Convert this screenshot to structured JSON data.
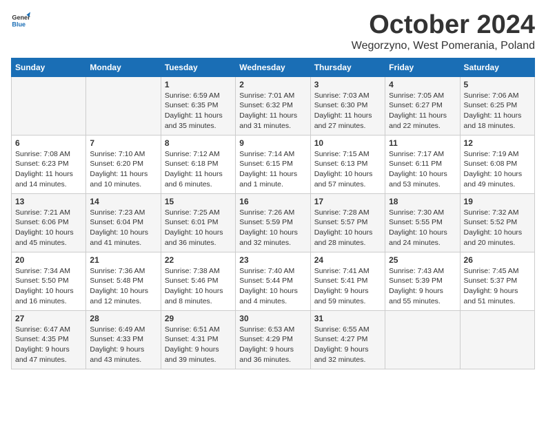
{
  "logo": {
    "general": "General",
    "blue": "Blue"
  },
  "title": {
    "month": "October 2024",
    "location": "Wegorzyno, West Pomerania, Poland"
  },
  "headers": [
    "Sunday",
    "Monday",
    "Tuesday",
    "Wednesday",
    "Thursday",
    "Friday",
    "Saturday"
  ],
  "weeks": [
    [
      {
        "day": "",
        "sunrise": "",
        "sunset": "",
        "daylight": ""
      },
      {
        "day": "",
        "sunrise": "",
        "sunset": "",
        "daylight": ""
      },
      {
        "day": "1",
        "sunrise": "Sunrise: 6:59 AM",
        "sunset": "Sunset: 6:35 PM",
        "daylight": "Daylight: 11 hours and 35 minutes."
      },
      {
        "day": "2",
        "sunrise": "Sunrise: 7:01 AM",
        "sunset": "Sunset: 6:32 PM",
        "daylight": "Daylight: 11 hours and 31 minutes."
      },
      {
        "day": "3",
        "sunrise": "Sunrise: 7:03 AM",
        "sunset": "Sunset: 6:30 PM",
        "daylight": "Daylight: 11 hours and 27 minutes."
      },
      {
        "day": "4",
        "sunrise": "Sunrise: 7:05 AM",
        "sunset": "Sunset: 6:27 PM",
        "daylight": "Daylight: 11 hours and 22 minutes."
      },
      {
        "day": "5",
        "sunrise": "Sunrise: 7:06 AM",
        "sunset": "Sunset: 6:25 PM",
        "daylight": "Daylight: 11 hours and 18 minutes."
      }
    ],
    [
      {
        "day": "6",
        "sunrise": "Sunrise: 7:08 AM",
        "sunset": "Sunset: 6:23 PM",
        "daylight": "Daylight: 11 hours and 14 minutes."
      },
      {
        "day": "7",
        "sunrise": "Sunrise: 7:10 AM",
        "sunset": "Sunset: 6:20 PM",
        "daylight": "Daylight: 11 hours and 10 minutes."
      },
      {
        "day": "8",
        "sunrise": "Sunrise: 7:12 AM",
        "sunset": "Sunset: 6:18 PM",
        "daylight": "Daylight: 11 hours and 6 minutes."
      },
      {
        "day": "9",
        "sunrise": "Sunrise: 7:14 AM",
        "sunset": "Sunset: 6:15 PM",
        "daylight": "Daylight: 11 hours and 1 minute."
      },
      {
        "day": "10",
        "sunrise": "Sunrise: 7:15 AM",
        "sunset": "Sunset: 6:13 PM",
        "daylight": "Daylight: 10 hours and 57 minutes."
      },
      {
        "day": "11",
        "sunrise": "Sunrise: 7:17 AM",
        "sunset": "Sunset: 6:11 PM",
        "daylight": "Daylight: 10 hours and 53 minutes."
      },
      {
        "day": "12",
        "sunrise": "Sunrise: 7:19 AM",
        "sunset": "Sunset: 6:08 PM",
        "daylight": "Daylight: 10 hours and 49 minutes."
      }
    ],
    [
      {
        "day": "13",
        "sunrise": "Sunrise: 7:21 AM",
        "sunset": "Sunset: 6:06 PM",
        "daylight": "Daylight: 10 hours and 45 minutes."
      },
      {
        "day": "14",
        "sunrise": "Sunrise: 7:23 AM",
        "sunset": "Sunset: 6:04 PM",
        "daylight": "Daylight: 10 hours and 41 minutes."
      },
      {
        "day": "15",
        "sunrise": "Sunrise: 7:25 AM",
        "sunset": "Sunset: 6:01 PM",
        "daylight": "Daylight: 10 hours and 36 minutes."
      },
      {
        "day": "16",
        "sunrise": "Sunrise: 7:26 AM",
        "sunset": "Sunset: 5:59 PM",
        "daylight": "Daylight: 10 hours and 32 minutes."
      },
      {
        "day": "17",
        "sunrise": "Sunrise: 7:28 AM",
        "sunset": "Sunset: 5:57 PM",
        "daylight": "Daylight: 10 hours and 28 minutes."
      },
      {
        "day": "18",
        "sunrise": "Sunrise: 7:30 AM",
        "sunset": "Sunset: 5:55 PM",
        "daylight": "Daylight: 10 hours and 24 minutes."
      },
      {
        "day": "19",
        "sunrise": "Sunrise: 7:32 AM",
        "sunset": "Sunset: 5:52 PM",
        "daylight": "Daylight: 10 hours and 20 minutes."
      }
    ],
    [
      {
        "day": "20",
        "sunrise": "Sunrise: 7:34 AM",
        "sunset": "Sunset: 5:50 PM",
        "daylight": "Daylight: 10 hours and 16 minutes."
      },
      {
        "day": "21",
        "sunrise": "Sunrise: 7:36 AM",
        "sunset": "Sunset: 5:48 PM",
        "daylight": "Daylight: 10 hours and 12 minutes."
      },
      {
        "day": "22",
        "sunrise": "Sunrise: 7:38 AM",
        "sunset": "Sunset: 5:46 PM",
        "daylight": "Daylight: 10 hours and 8 minutes."
      },
      {
        "day": "23",
        "sunrise": "Sunrise: 7:40 AM",
        "sunset": "Sunset: 5:44 PM",
        "daylight": "Daylight: 10 hours and 4 minutes."
      },
      {
        "day": "24",
        "sunrise": "Sunrise: 7:41 AM",
        "sunset": "Sunset: 5:41 PM",
        "daylight": "Daylight: 9 hours and 59 minutes."
      },
      {
        "day": "25",
        "sunrise": "Sunrise: 7:43 AM",
        "sunset": "Sunset: 5:39 PM",
        "daylight": "Daylight: 9 hours and 55 minutes."
      },
      {
        "day": "26",
        "sunrise": "Sunrise: 7:45 AM",
        "sunset": "Sunset: 5:37 PM",
        "daylight": "Daylight: 9 hours and 51 minutes."
      }
    ],
    [
      {
        "day": "27",
        "sunrise": "Sunrise: 6:47 AM",
        "sunset": "Sunset: 4:35 PM",
        "daylight": "Daylight: 9 hours and 47 minutes."
      },
      {
        "day": "28",
        "sunrise": "Sunrise: 6:49 AM",
        "sunset": "Sunset: 4:33 PM",
        "daylight": "Daylight: 9 hours and 43 minutes."
      },
      {
        "day": "29",
        "sunrise": "Sunrise: 6:51 AM",
        "sunset": "Sunset: 4:31 PM",
        "daylight": "Daylight: 9 hours and 39 minutes."
      },
      {
        "day": "30",
        "sunrise": "Sunrise: 6:53 AM",
        "sunset": "Sunset: 4:29 PM",
        "daylight": "Daylight: 9 hours and 36 minutes."
      },
      {
        "day": "31",
        "sunrise": "Sunrise: 6:55 AM",
        "sunset": "Sunset: 4:27 PM",
        "daylight": "Daylight: 9 hours and 32 minutes."
      },
      {
        "day": "",
        "sunrise": "",
        "sunset": "",
        "daylight": ""
      },
      {
        "day": "",
        "sunrise": "",
        "sunset": "",
        "daylight": ""
      }
    ]
  ]
}
